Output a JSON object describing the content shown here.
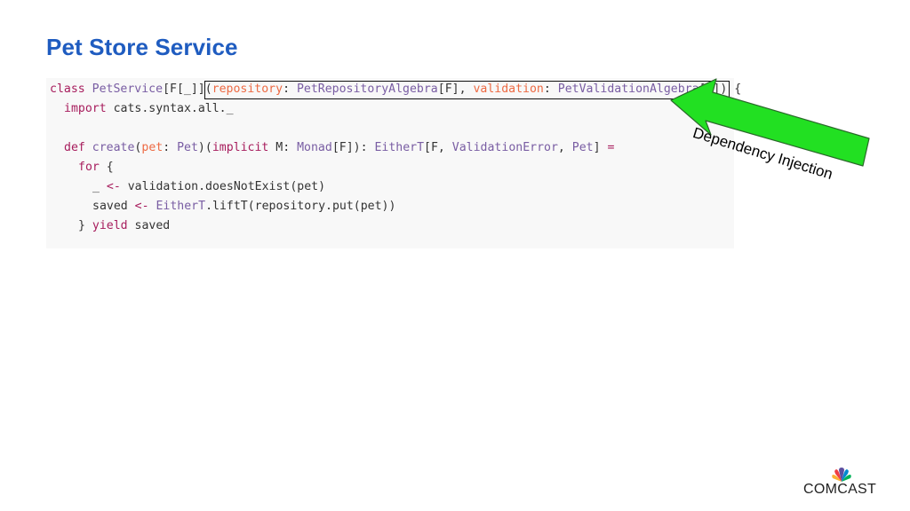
{
  "slide": {
    "title": "Pet Store Service"
  },
  "code": {
    "line1": {
      "kw_class": "class",
      "name": "PetService",
      "tparams": "[F[_]]",
      "open": "(",
      "p1_name": "repository",
      "colon1": ": ",
      "p1_type": "PetRepositoryAlgebra",
      "p1_targ": "[F], ",
      "p2_name": "validation",
      "colon2": ": ",
      "p2_type": "PetValidationAlgebra",
      "p2_targ": "[F]) {"
    },
    "line2": {
      "kw_import": "import",
      "rest": " cats.syntax.all._"
    },
    "line4": {
      "kw_def": "def",
      "name": "create",
      "open": "(",
      "p_name": "pet",
      "colon": ": ",
      "p_type": "Pet",
      "mid": ")(",
      "kw_implicit": "implicit",
      "implicit_rest": " M: ",
      "monad": "Monad",
      "monad_args": "[F]): ",
      "ret1": "EitherT",
      "ret_open": "[F, ",
      "ret2": "ValidationError",
      "comma": ", ",
      "ret3": "Pet",
      "ret_close": "] ",
      "eq": "="
    },
    "line5": {
      "kw_for": "for",
      "rest": " {"
    },
    "line6": {
      "lhs": "_ ",
      "arrow": "<-",
      "rest": " validation.doesNotExist(pet)"
    },
    "line7": {
      "lhs": "saved ",
      "arrow": "<-",
      "sp": " ",
      "ty": "EitherT",
      "rest": ".liftT(repository.put(pet))"
    },
    "line8": {
      "close": "} ",
      "kw_yield": "yield",
      "rest": " saved"
    }
  },
  "annotation": {
    "label": "Dependency Injection",
    "arrow_color": "#22e022"
  },
  "logo": {
    "text": "COMCAST"
  },
  "colors": {
    "title": "#1f5cc0",
    "keyword": "#a71d5d",
    "type": "#795da3",
    "param": "#ed6a43",
    "code_bg": "#f8f8f8"
  }
}
